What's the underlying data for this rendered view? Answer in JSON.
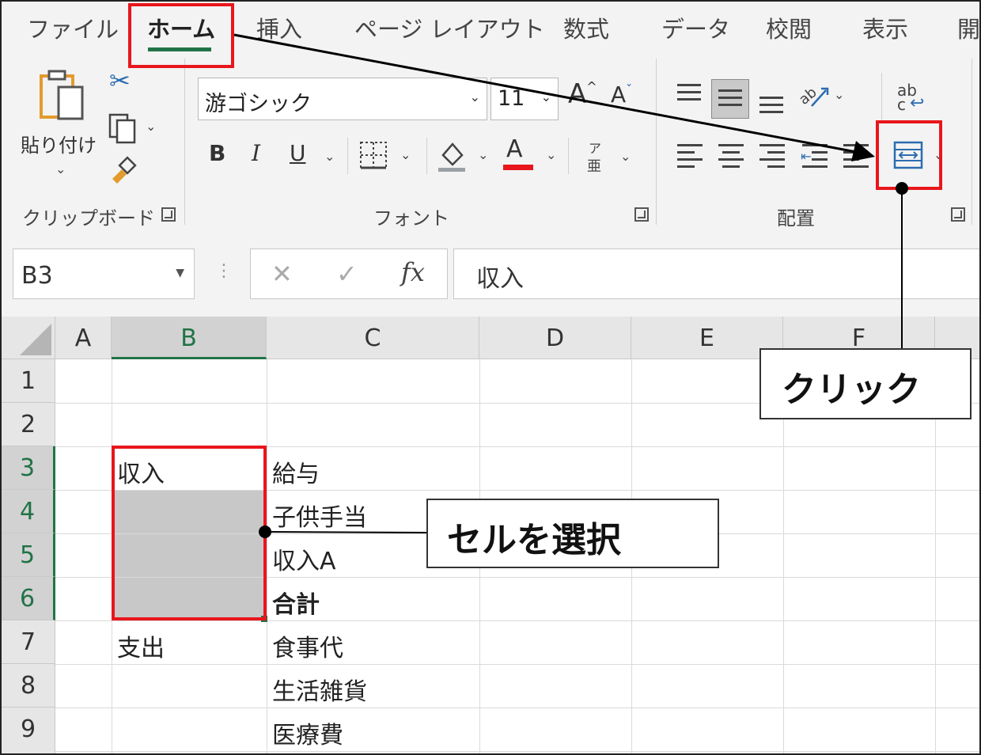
{
  "tabs": [
    "ファイル",
    "ホーム",
    "挿入",
    "ページ レイアウト",
    "数式",
    "データ",
    "校閲",
    "表示",
    "開"
  ],
  "clipboard": {
    "paste_label": "貼り付け",
    "group_label": "クリップボード"
  },
  "font": {
    "name": "游ゴシック",
    "size": "11",
    "bold": "B",
    "italic": "I",
    "underline": "U",
    "color_letter": "A",
    "grow": "A",
    "shrink": "A",
    "phonetic_top": "ア",
    "phonetic_bottom": "亜",
    "group_label": "フォント"
  },
  "alignment": {
    "wrap_top": "ab",
    "wrap_bottom": "c",
    "group_label": "配置"
  },
  "formula_bar": {
    "name_box": "B3",
    "fx": "fx",
    "content": "収入"
  },
  "columns": [
    "A",
    "B",
    "C",
    "D",
    "E",
    "F"
  ],
  "rows": [
    "1",
    "2",
    "3",
    "4",
    "5",
    "6",
    "7",
    "8",
    "9"
  ],
  "cells": {
    "B3": "収入",
    "B7": "支出",
    "C3": "給与",
    "C4": "子供手当",
    "C5": "収入A",
    "C6": "合計",
    "C7": "食事代",
    "C8": "生活雑貨",
    "C9": "医療費"
  },
  "annotations": {
    "click": "クリック",
    "select_cells": "セルを選択"
  },
  "colors": {
    "accent_green": "#217346",
    "highlight_red": "#e8161c",
    "selection_gray": "#c8c8c8",
    "ribbon_bg": "#f3f3f3"
  },
  "icons": [
    "paste-icon",
    "cut-icon",
    "copy-icon",
    "format-painter-icon",
    "font-color-icon",
    "fill-color-icon",
    "borders-icon",
    "orientation-icon",
    "wrap-text-icon",
    "merge-center-icon",
    "decrease-indent-icon",
    "increase-indent-icon"
  ]
}
